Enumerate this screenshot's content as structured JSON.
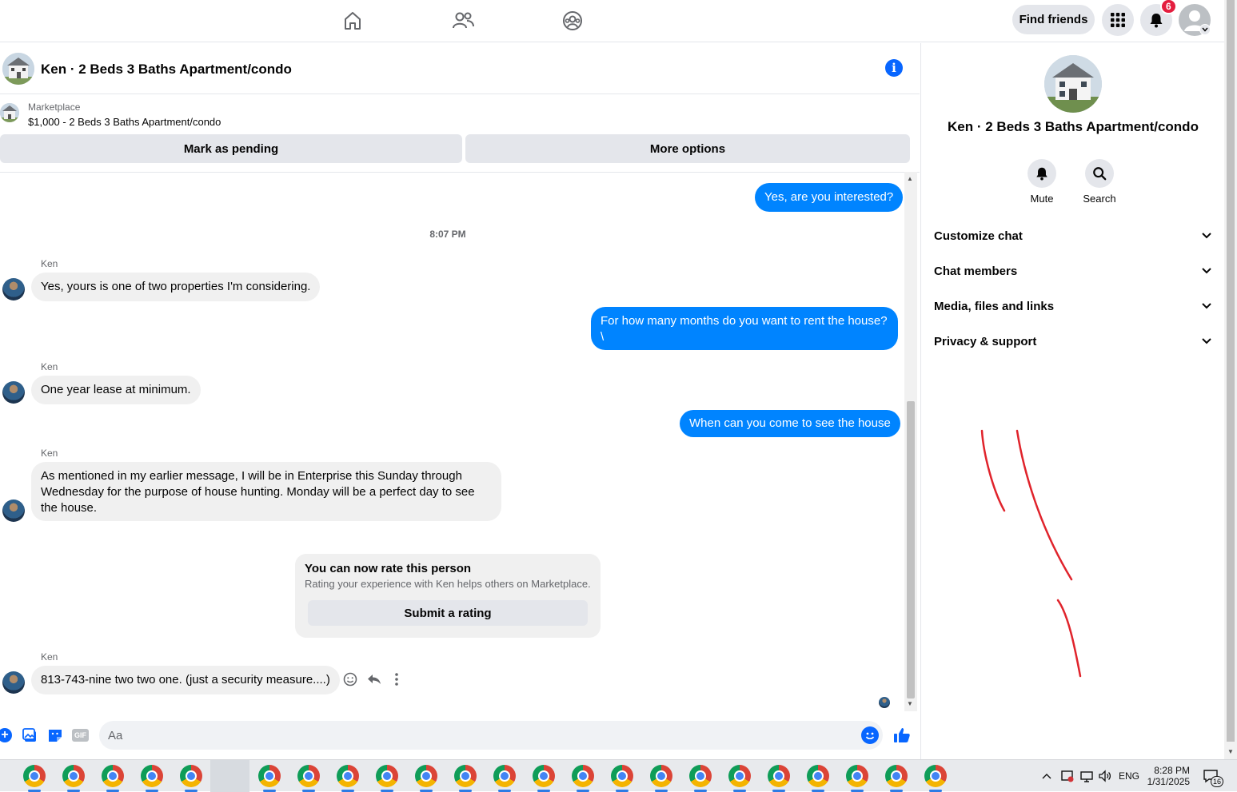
{
  "topbar": {
    "find_friends_label": "Find friends",
    "notification_count": "6"
  },
  "chat": {
    "title": "Ken · 2 Beds 3 Baths Apartment/condo",
    "marketplace_label": "Marketplace",
    "listing": "$1,000 - 2 Beds 3 Baths Apartment/condo",
    "mark_pending_label": "Mark as pending",
    "more_options_label": "More options"
  },
  "messages": {
    "out_1": "Yes, are you interested?",
    "timestamp": "8:07 PM",
    "sender_name": "Ken",
    "in_1": "Yes, yours is one of two properties I'm considering.",
    "out_2_line1": "For how many months do you want to rent the house?",
    "out_2_line2": "\\",
    "in_2": "One year lease at minimum.",
    "out_3": "When can you come to see the house",
    "in_3": "As mentioned in my earlier message, I will be in Enterprise this Sunday through Wednesday for the purpose of house hunting. Monday will be a perfect day to see the house.",
    "in_4": "813-743-nine two two one. (just a security measure....)"
  },
  "rating": {
    "title": "You can now rate this person",
    "subtitle": "Rating your experience with Ken helps others on Marketplace.",
    "button_label": "Submit a rating"
  },
  "composer": {
    "placeholder": "Aa",
    "gif_label": "GIF"
  },
  "right_panel": {
    "title": "Ken · 2 Beds 3 Baths Apartment/condo",
    "mute_label": "Mute",
    "search_label": "Search",
    "sections": [
      "Customize chat",
      "Chat members",
      "Media, files and links",
      "Privacy & support"
    ]
  },
  "taskbar": {
    "language": "ENG",
    "time": "8:28 PM",
    "date": "1/31/2025",
    "notification_count": "16"
  },
  "colors": {
    "accent": "#0084ff",
    "brand": "#0866ff",
    "badge": "#e41e3f",
    "annotation": "#e0242c"
  }
}
